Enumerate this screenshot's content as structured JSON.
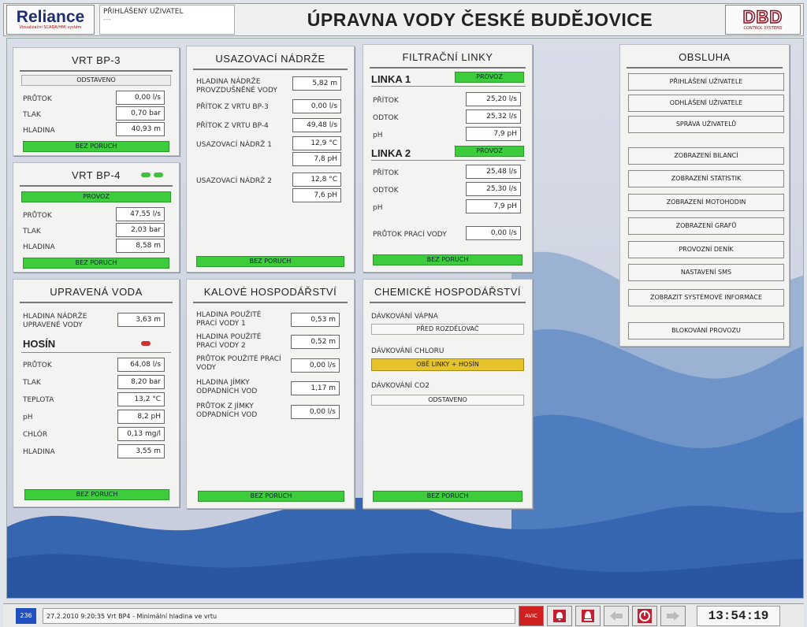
{
  "header": {
    "logo": "Reliance",
    "logo_sub": "Vizualizační SCADA/HMI systém",
    "user_label": "PŘIHLÁŠENÝ UŽIVATEL",
    "user_value": "---",
    "title": "ÚPRAVNA VODY ČESKÉ BUDĚJOVICE",
    "brand": "DBD",
    "brand_sub": "CONTROL SYSTEMS"
  },
  "vrt3": {
    "title": "VRT BP-3",
    "state": "ODSTAVENO",
    "rows": [
      {
        "label": "PRŮTOK",
        "value": "0,00 l/s"
      },
      {
        "label": "TLAK",
        "value": "0,70 bar"
      },
      {
        "label": "HLADINA",
        "value": "40,93 m"
      }
    ],
    "fault": "BEZ PORUCH"
  },
  "vrt4": {
    "title": "VRT BP-4",
    "state": "PROVOZ",
    "rows": [
      {
        "label": "PRŮTOK",
        "value": "47,55 l/s"
      },
      {
        "label": "TLAK",
        "value": "2,03 bar"
      },
      {
        "label": "HLADINA",
        "value": "8,58 m"
      }
    ],
    "fault": "BEZ PORUCH"
  },
  "upravena": {
    "title": "UPRAVENÁ VODA",
    "level_label": "HLADINA NÁDRŽE UPRAVENÉ VODY",
    "level_value": "3,63 m",
    "hosin": "HOSÍN",
    "rows": [
      {
        "label": "PRŮTOK",
        "value": "64,08 l/s"
      },
      {
        "label": "TLAK",
        "value": "8,20 bar"
      },
      {
        "label": "TEPLOTA",
        "value": "13,2 °C"
      },
      {
        "label": "pH",
        "value": "8,2 pH"
      },
      {
        "label": "CHLÓR",
        "value": "0,13 mg/l"
      },
      {
        "label": "HLADINA",
        "value": "3,55 m"
      }
    ],
    "fault": "BEZ PORUCH"
  },
  "usaz": {
    "title": "USAZOVACÍ NÁDRŽE",
    "rows": [
      {
        "label": "HLADINA NÁDRŽE PROVZDUŠNĚNÉ VODY",
        "value": "5,82 m"
      },
      {
        "label": "PŘÍTOK Z VRTU BP-3",
        "value": "0,00 l/s"
      },
      {
        "label": "PŘÍTOK Z VRTU BP-4",
        "value": "49,48 l/s"
      },
      {
        "label": "USAZOVACÍ NÁDRŽ 1",
        "value": "12,9 °C",
        "value2": "7,8 pH"
      },
      {
        "label": "USAZOVACÍ NÁDRŽ 2",
        "value": "12,8 °C",
        "value2": "7,6 pH"
      }
    ],
    "fault": "BEZ PORUCH"
  },
  "kal": {
    "title": "KALOVÉ HOSPODÁŘSTVÍ",
    "rows": [
      {
        "label": "HLADINA POUŽITÉ PRACÍ VODY 1",
        "value": "0,53 m"
      },
      {
        "label": "HLADINA POUŽITÉ PRACÍ VODY 2",
        "value": "0,52 m"
      },
      {
        "label": "PRŮTOK POUŽITÉ PRACÍ VODY",
        "value": "0,00 l/s"
      },
      {
        "label": "HLADINA JÍMKY ODPADNÍCH VOD",
        "value": "1,17 m"
      },
      {
        "label": "PRŮTOK Z JÍMKY ODPADNÍCH VOD",
        "value": "0,00 l/s"
      }
    ],
    "fault": "BEZ PORUCH"
  },
  "filtr": {
    "title": "FILTRAČNÍ LINKY",
    "l1": "LINKA 1",
    "l1_state": "PROVOZ",
    "l1_rows": [
      {
        "label": "PŘÍTOK",
        "value": "25,20 l/s"
      },
      {
        "label": "ODTOK",
        "value": "25,32 l/s"
      },
      {
        "label": "pH",
        "value": "7,9 pH"
      }
    ],
    "l2": "LINKA 2",
    "l2_state": "PROVOZ",
    "l2_rows": [
      {
        "label": "PŘÍTOK",
        "value": "25,48 l/s"
      },
      {
        "label": "ODTOK",
        "value": "25,30 l/s"
      },
      {
        "label": "pH",
        "value": "7,9 pH"
      }
    ],
    "wash_label": "PRŮTOK PRACÍ VODY",
    "wash_value": "0,00 l/s",
    "fault": "BEZ PORUCH"
  },
  "chem": {
    "title": "CHEMICKÉ HOSPODÁŘSTVÍ",
    "vapno_label": "DÁVKOVÁNÍ VÁPNA",
    "vapno_value": "PŘED ROZDĚLOVAČ",
    "chlor_label": "DÁVKOVÁNÍ CHLORU",
    "chlor_value": "OBĚ LINKY + HOSÍN",
    "co2_label": "DÁVKOVÁNÍ CO2",
    "co2_value": "ODSTAVENO",
    "fault": "BEZ PORUCH"
  },
  "obsluha": {
    "title": "OBSLUHA",
    "buttons": [
      "PŘIHLÁŠENÍ UŽIVATELE",
      "ODHLÁŠENÍ UŽIVATELE",
      "SPRÁVA UŽIVATELŮ",
      "ZOBRAZENÍ BILANCÍ",
      "ZOBRAZENÍ STATISTIK",
      "ZOBRAZENÍ MOTOHODIN",
      "ZOBRAZENÍ GRAFŮ",
      "PROVOZNÍ DENÍK",
      "NASTAVENÍ SMS",
      "ZOBRAZIT SYSTÉMOVÉ INFORMACE",
      "BLOKOVÁNÍ PROVOZU"
    ]
  },
  "statusbar": {
    "count": "236",
    "message": "27.2.2010 9:20:35  Vrt BP4 - Minimální hladina ve vrtu",
    "ack": "AVIC",
    "clock": "13:54:19"
  },
  "colors": {
    "ok": "#3ccc3c",
    "warn": "#e5c32a",
    "alarm": "#d02020",
    "water": "#2e6fc0"
  }
}
